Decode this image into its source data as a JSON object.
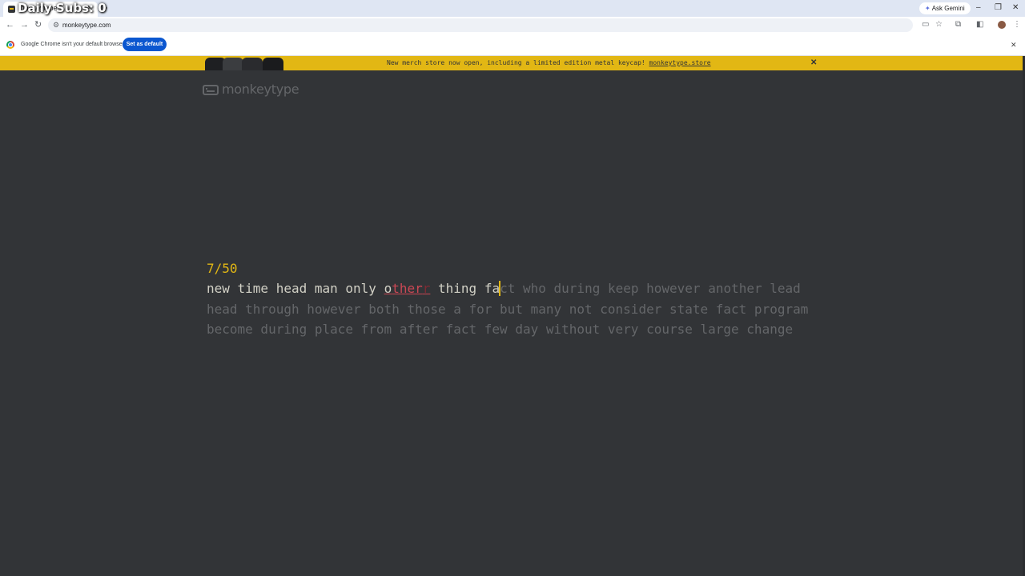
{
  "browser": {
    "overlay_text": "Daily Subs: 0",
    "tab": {
      "title": "monkeytype"
    },
    "ask_gemini": "Ask Gemini",
    "url": "monkeytype.com",
    "infobar": {
      "message": "Google Chrome isn't your default browser",
      "button": "Set as default"
    }
  },
  "banner": {
    "text": "New merch store now open, including a limited edition metal keycap! ",
    "link": "monkeytype.store"
  },
  "logo": {
    "text": "monkeytype"
  },
  "test": {
    "counter": "7/50",
    "lines": [
      {
        "typed": [
          "new",
          "time",
          "head",
          "man",
          "only"
        ],
        "error_word": {
          "correct": "o",
          "wrong": "ther",
          "extra": "r"
        },
        "typed_after": "thing",
        "active": {
          "typed": "fa",
          "rest": "ct"
        },
        "untyped": "who during keep however another lead"
      },
      {
        "untyped": "head through however both those a for but many not consider state fact program"
      },
      {
        "untyped": "become during place from after fact few day without very course large change"
      }
    ]
  },
  "colors": {
    "background": "#323437",
    "accent": "#e2b714",
    "typed": "#d1d0c5",
    "untyped": "#646669",
    "error": "#ca4754",
    "extra": "#7e2a33"
  }
}
